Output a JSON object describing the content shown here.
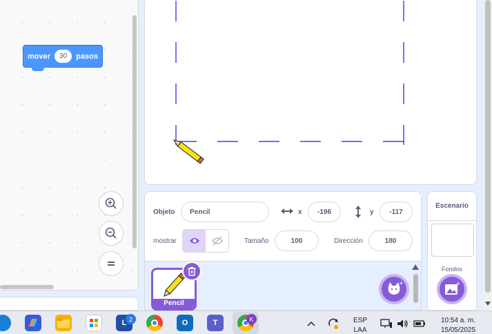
{
  "code_block": {
    "verb": "mover",
    "value": "30",
    "unit": "pasos"
  },
  "sprite_info": {
    "sprite_label": "Objeto",
    "sprite_name": "Pencil",
    "x_label": "x",
    "x_value": "-196",
    "y_label": "y",
    "y_value": "-117",
    "show_label": "mostrar",
    "size_label": "Tamaño",
    "size_value": "100",
    "direction_label": "Dirección",
    "direction_value": "180"
  },
  "sprite_list": {
    "items": [
      {
        "name": "Pencil"
      }
    ]
  },
  "stage_panel": {
    "title": "Escenario",
    "backdrops_label": "Fondos"
  },
  "taskbar": {
    "teams_badge": "2",
    "profile_badge": "K",
    "language": "ESP",
    "layout": "LAA",
    "time": "10:54 a. m.",
    "date": "15/05/2025"
  },
  "colors": {
    "accent": "#855cd6",
    "motion_block": "#4c97ff",
    "pen_line": "#1a1adb"
  },
  "icons": [
    "zoom-in-icon",
    "zoom-out-icon",
    "zoom-reset-icon",
    "eye-icon",
    "eye-hidden-icon",
    "trash-icon",
    "choose-sprite-icon",
    "choose-backdrop-icon"
  ]
}
